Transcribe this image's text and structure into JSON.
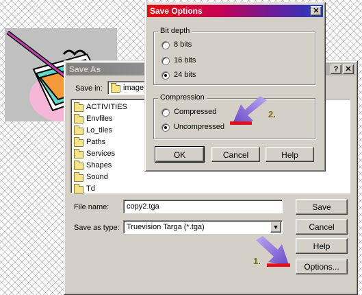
{
  "save_options": {
    "title": "Save Options",
    "bit_depth": {
      "legend": "Bit depth",
      "options": [
        "8 bits",
        "16 bits",
        "24 bits"
      ],
      "selected": "24 bits"
    },
    "compression": {
      "legend": "Compression",
      "options": [
        "Compressed",
        "Uncompressed"
      ],
      "selected": "Uncompressed"
    },
    "ok_label": "OK",
    "cancel_label": "Cancel",
    "help_label": "Help",
    "close_glyph": "✕",
    "annotation": "2."
  },
  "save_as": {
    "title": "Save As",
    "help_glyph": "?",
    "close_glyph": "✕",
    "save_in_label": "Save in:",
    "save_in_value": "images",
    "folders": [
      "ACTIVITIES",
      "Envfiles",
      "Lo_tiles",
      "Paths",
      "Services",
      "Shapes",
      "Sound",
      "Td"
    ],
    "file_name_label": "File name:",
    "file_name_value": "copy2.tga",
    "save_as_type_label": "Save as type:",
    "save_as_type_value": "Truevision Targa (*.tga)",
    "save_label": "Save",
    "cancel_label": "Cancel",
    "help_label": "Help",
    "options_label": "Options...",
    "annotation": "1."
  },
  "colors": {
    "active_title_start": "#e01010",
    "active_title_end": "#2040c0",
    "arrow": "#9a78d8",
    "annotation_text": "#7a6a00"
  }
}
